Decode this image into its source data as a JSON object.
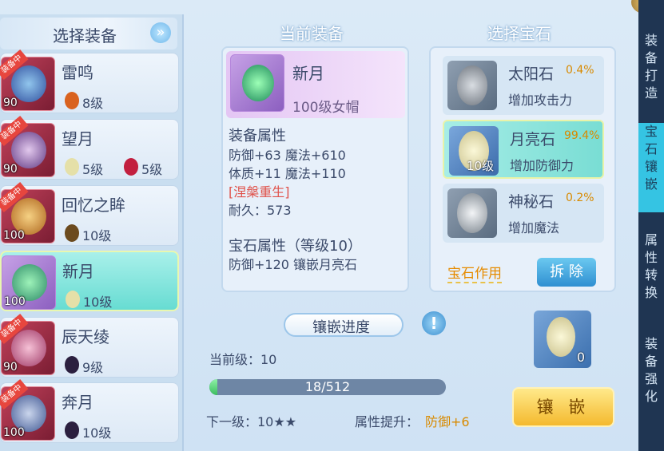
{
  "left": {
    "title": "选择装备",
    "items": [
      {
        "name": "雷鸣",
        "level": "90",
        "tag": "装备中",
        "gems": [
          {
            "label": "8级",
            "color": "#d9621f"
          }
        ]
      },
      {
        "name": "望月",
        "level": "90",
        "tag": "装备中",
        "gems": [
          {
            "label": "5级",
            "color": "#e5e0a8"
          },
          {
            "label": "5级",
            "color": "#c21f3f"
          }
        ]
      },
      {
        "name": "回忆之眸",
        "level": "100",
        "tag": "装备中",
        "gems": [
          {
            "label": "10级",
            "color": "#6b4a1e"
          }
        ]
      },
      {
        "name": "新月",
        "level": "100",
        "tag": "",
        "gems": [
          {
            "label": "10级",
            "color": "#e5e0a8"
          }
        ]
      },
      {
        "name": "辰天绫",
        "level": "90",
        "tag": "装备中",
        "gems": [
          {
            "label": "9级",
            "color": "#2b1f3f"
          }
        ]
      },
      {
        "name": "奔月",
        "level": "100",
        "tag": "装备中",
        "gems": [
          {
            "label": "10级",
            "color": "#2b1f3f"
          }
        ]
      }
    ]
  },
  "center": {
    "title": "当前装备",
    "equip_name": "新月",
    "equip_type": "100级女帽",
    "attr_title": "装备属性",
    "attr_line1": "防御+63 魔法+610",
    "attr_line2": "体质+11 魔法+110",
    "special": "[涅槃重生]",
    "durability": "耐久：573",
    "gem_attr_title": "宝石属性（等级10）",
    "gem_attr_line": "防御+120 镶嵌月亮石",
    "inlay_label": "镶嵌进度",
    "current_level": "当前级：10",
    "progress_text": "18/512",
    "progress": 0.035,
    "next_level": "下一级：10★★",
    "attr_up_label": "属性提升：",
    "attr_up_value": "防御+6"
  },
  "right": {
    "title": "选择宝石",
    "gems": [
      {
        "name": "太阳石",
        "pct": "0.4%",
        "desc": "增加攻击力",
        "level": ""
      },
      {
        "name": "月亮石",
        "pct": "99.4%",
        "desc": "增加防御力",
        "level": "10级"
      },
      {
        "name": "神秘石",
        "pct": "0.2%",
        "desc": "增加魔法",
        "level": ""
      }
    ],
    "effect_label": "宝石作用",
    "remove_label": "拆 除",
    "slot_count": "0",
    "inlay_button": "镶 嵌"
  },
  "side_tabs": [
    "装备打造",
    "宝石镶嵌",
    "属性转换",
    "装备强化"
  ]
}
